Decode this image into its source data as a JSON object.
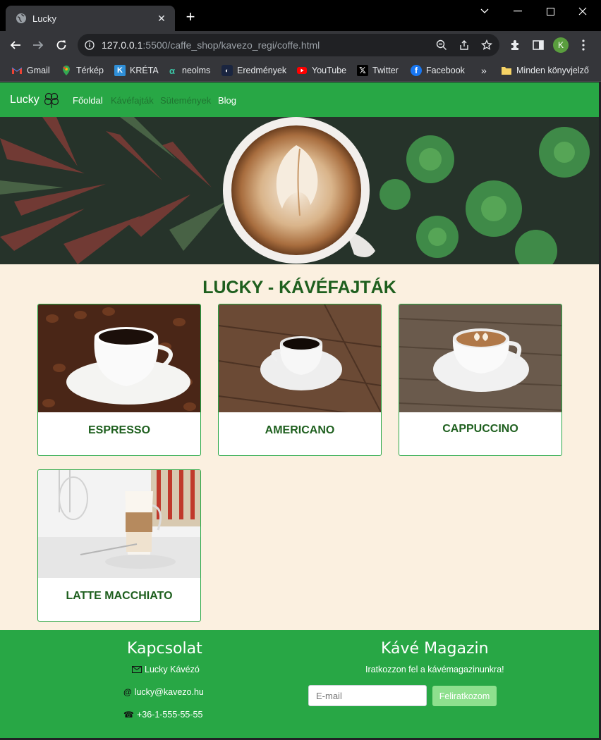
{
  "browser": {
    "tab_title": "Lucky",
    "tab_close": "✕",
    "new_tab": "+",
    "url_host": "127.0.0.1",
    "url_rest": ":5500/caffe_shop/kavezo_regi/coffe.html",
    "profile_initial": "K"
  },
  "bookmarks": [
    {
      "label": "Gmail",
      "icon": "gmail-icon"
    },
    {
      "label": "Térkép",
      "icon": "maps-icon"
    },
    {
      "label": "KRÉTA",
      "icon": "kreta-icon"
    },
    {
      "label": "neolms",
      "icon": "neolms-icon"
    },
    {
      "label": "Eredmények",
      "icon": "eredmenyek-icon"
    },
    {
      "label": "YouTube",
      "icon": "youtube-icon"
    },
    {
      "label": "Twitter",
      "icon": "twitter-icon"
    },
    {
      "label": "Facebook",
      "icon": "facebook-icon"
    }
  ],
  "bookmarks_more": "»",
  "bookmarks_folder": "Minden könyvjelző",
  "site": {
    "brand": "Lucky",
    "nav": [
      "Főoldal",
      "Kávéfajták",
      "Sütemények",
      "Blog"
    ],
    "title": "LUCKY - KÁVÉFAJTÁK",
    "cards": [
      "ESPRESSO",
      "AMERICANO",
      "CAPPUCCINO",
      "LATTE MACCHIATO"
    ]
  },
  "footer": {
    "contact_title": "Kapcsolat",
    "contact_name": "Lucky Kávézó",
    "contact_email": "lucky@kavezo.hu",
    "contact_phone": "+36-1-555-55-55",
    "magazine_title": "Kávé Magazin",
    "magazine_text": "Iratkozzon fel a kávémagazinunkra!",
    "email_placeholder": "E-mail",
    "subscribe_label": "Feliratkozom"
  },
  "colors": {
    "accent": "#28a745",
    "heading": "#1e5f1e",
    "page_bg": "#fbf0e0"
  }
}
